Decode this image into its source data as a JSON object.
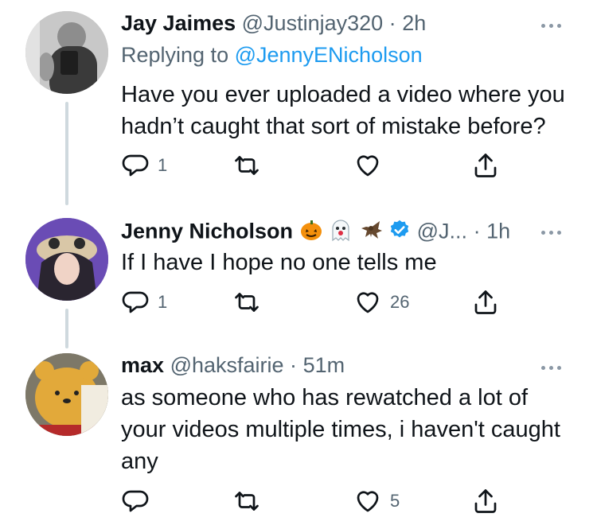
{
  "tweets": [
    {
      "name": "Jay Jaimes",
      "handle": "@Justinjay320",
      "dot": "·",
      "time": "2h",
      "replying_prefix": "Replying to ",
      "replying_to": "@JennyENicholson",
      "text": "Have you ever uploaded a video where you hadn’t caught that sort of mistake before?",
      "reply_count": "1",
      "retweet_count": "",
      "like_count": ""
    },
    {
      "name": "Jenny Nicholson",
      "name_emojis": [
        "pumpkin-icon",
        "ghost-icon",
        "bat-icon"
      ],
      "verified": true,
      "handle": "@J...",
      "dot": "·",
      "time": "1h",
      "text": "If I have I hope no one tells me",
      "reply_count": "1",
      "retweet_count": "",
      "like_count": "26"
    },
    {
      "name": "max",
      "handle": "@haksfairie",
      "dot": "·",
      "time": "51m",
      "text": "as someone who has rewatched a lot of your videos multiple times, i haven't caught any",
      "reply_count": "",
      "retweet_count": "",
      "like_count": "5"
    }
  ],
  "colors": {
    "accent": "#1d9bf0",
    "secondary": "#536471",
    "thread_line": "#cfd9de"
  }
}
